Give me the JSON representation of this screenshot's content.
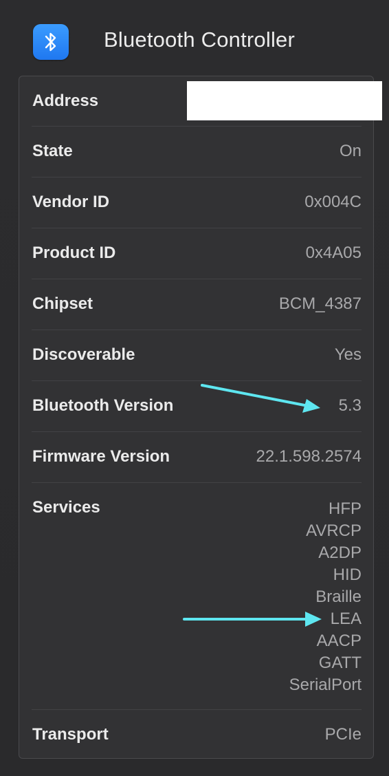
{
  "header": {
    "title": "Bluetooth Controller",
    "icon": "bluetooth-icon",
    "icon_color": "#2a86f7"
  },
  "rows": {
    "address": {
      "label": "Address",
      "value": ""
    },
    "state": {
      "label": "State",
      "value": "On"
    },
    "vendor_id": {
      "label": "Vendor ID",
      "value": "0x004C"
    },
    "product_id": {
      "label": "Product ID",
      "value": "0x4A05"
    },
    "chipset": {
      "label": "Chipset",
      "value": "BCM_4387"
    },
    "discoverable": {
      "label": "Discoverable",
      "value": "Yes"
    },
    "bluetooth_version": {
      "label": "Bluetooth Version",
      "value": "5.3"
    },
    "firmware_version": {
      "label": "Firmware Version",
      "value": "22.1.598.2574"
    },
    "services": {
      "label": "Services",
      "values": [
        "HFP",
        "AVRCP",
        "A2DP",
        "HID",
        "Braille",
        "LEA",
        "AACP",
        "GATT",
        "SerialPort"
      ]
    },
    "transport": {
      "label": "Transport",
      "value": "PCIe"
    }
  },
  "annotations": {
    "arrow_color": "#5ee6f0",
    "arrow_targets": [
      "Bluetooth Version value",
      "LEA service"
    ]
  }
}
